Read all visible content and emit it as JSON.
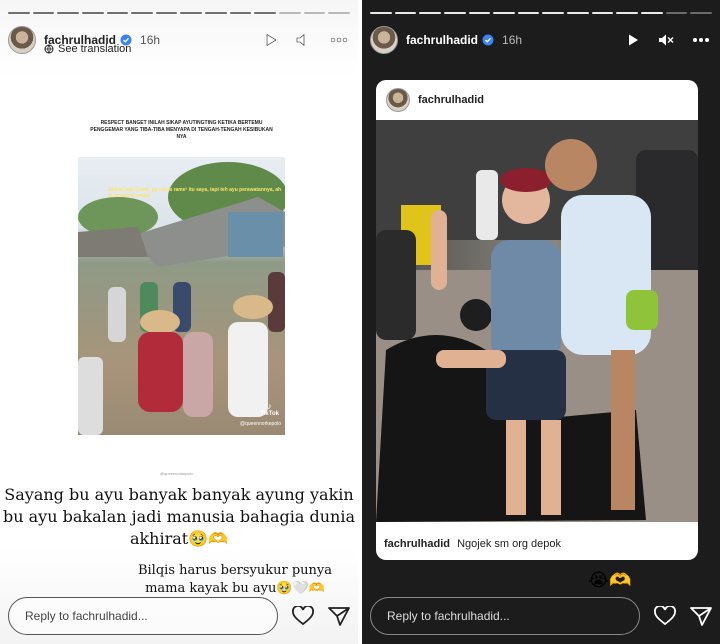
{
  "left_story": {
    "username": "fachrulhadid",
    "time": "16h",
    "see_translation": "See translation",
    "video": {
      "caption": "RESPECT BANGET INILAH SIKAP AYUTINGTING KETIKA BERTEMU PENGGEMAR YANG TIBA-TIBA MENYAPA DI TENGAH-TENGAH KESIBUKAN NYA",
      "overlay": "Giliran ada Emak² yg minta rame² itu saya, tapi teh ayu perawatannya, ah fo fo samu semua",
      "tiktok_label": "TikTok",
      "tiktok_handle": "@queennorkepolo",
      "watermark": "@queennorkepolo"
    },
    "caption_main": "Sayang bu ayu banyak banyak ayung yakin bu ayu bakalan jadi manusia bahagia dunia akhirat🥹🫶",
    "caption_secondary": "Bilqis harus bersyukur punya mama kayak bu ayu🥹🤍🫶",
    "reply_placeholder": "Reply to fachrulhadid..."
  },
  "right_story": {
    "username": "fachrulhadid",
    "time": "16h",
    "post": {
      "username": "fachrulhadid",
      "caption_user": "fachrulhadid",
      "caption_text": "Ngojek sm org depok"
    },
    "reactions": "😭🫶",
    "reply_placeholder": "Reply to fachrulhadid..."
  },
  "icons": {
    "play": "play-icon",
    "volume": "volume-icon",
    "mute": "mute-icon",
    "more": "more-icon",
    "heart": "heart-icon",
    "send": "send-icon"
  }
}
